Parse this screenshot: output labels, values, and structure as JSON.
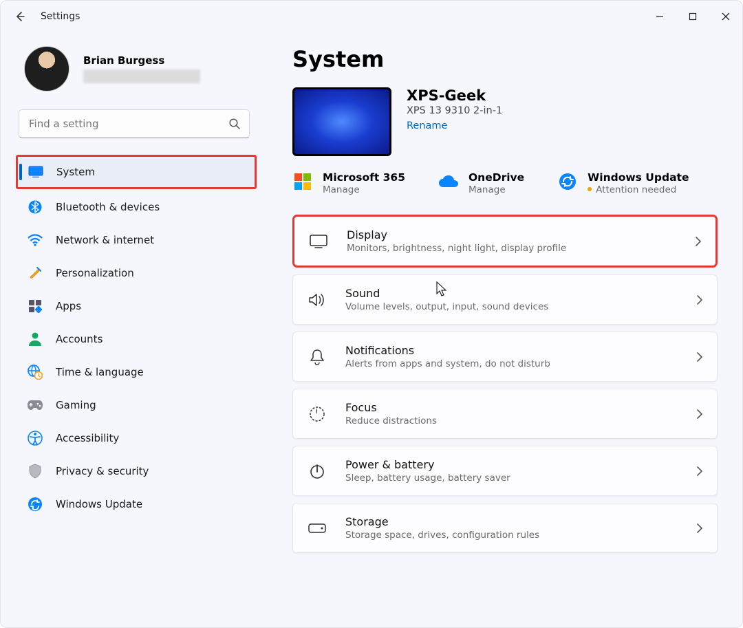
{
  "titlebar": {
    "app": "Settings"
  },
  "profile": {
    "name": "Brian Burgess"
  },
  "search": {
    "placeholder": "Find a setting"
  },
  "nav": [
    {
      "key": "system",
      "label": "System",
      "selected": true
    },
    {
      "key": "bluetooth",
      "label": "Bluetooth & devices"
    },
    {
      "key": "network",
      "label": "Network & internet"
    },
    {
      "key": "personalization",
      "label": "Personalization"
    },
    {
      "key": "apps",
      "label": "Apps"
    },
    {
      "key": "accounts",
      "label": "Accounts"
    },
    {
      "key": "time",
      "label": "Time & language"
    },
    {
      "key": "gaming",
      "label": "Gaming"
    },
    {
      "key": "accessibility",
      "label": "Accessibility"
    },
    {
      "key": "privacy",
      "label": "Privacy & security"
    },
    {
      "key": "update",
      "label": "Windows Update"
    }
  ],
  "page": {
    "title": "System",
    "device": {
      "name": "XPS-Geek",
      "model": "XPS 13 9310 2-in-1",
      "rename": "Rename"
    },
    "tiles": {
      "m365": {
        "title": "Microsoft 365",
        "sub": "Manage"
      },
      "onedrive": {
        "title": "OneDrive",
        "sub": "Manage"
      },
      "winupdate": {
        "title": "Windows Update",
        "sub": "Attention needed"
      }
    },
    "cards": [
      {
        "key": "display",
        "title": "Display",
        "sub": "Monitors, brightness, night light, display profile"
      },
      {
        "key": "sound",
        "title": "Sound",
        "sub": "Volume levels, output, input, sound devices"
      },
      {
        "key": "notifications",
        "title": "Notifications",
        "sub": "Alerts from apps and system, do not disturb"
      },
      {
        "key": "focus",
        "title": "Focus",
        "sub": "Reduce distractions"
      },
      {
        "key": "power",
        "title": "Power & battery",
        "sub": "Sleep, battery usage, battery saver"
      },
      {
        "key": "storage",
        "title": "Storage",
        "sub": "Storage space, drives, configuration rules"
      }
    ]
  }
}
